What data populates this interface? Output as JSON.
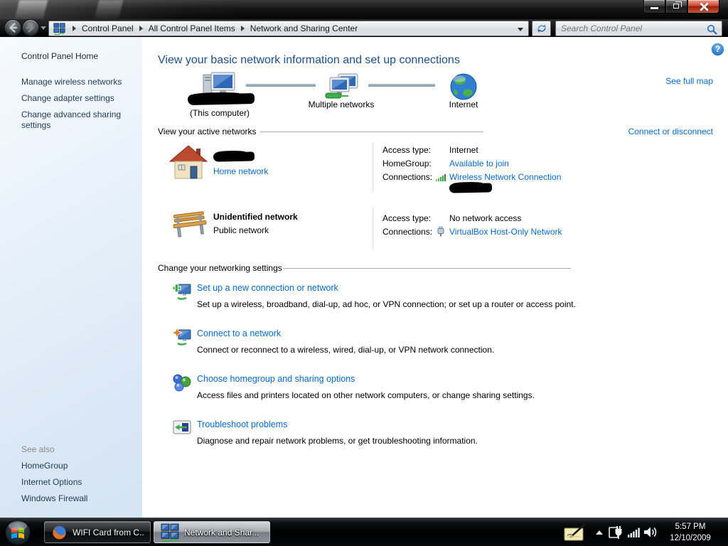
{
  "address_bar": {
    "breadcrumb": {
      "items": [
        "Control Panel",
        "All Control Panel Items",
        "Network and Sharing Center"
      ]
    },
    "search": {
      "placeholder": "Search Control Panel"
    }
  },
  "help": {
    "glyph": "?"
  },
  "sidebar": {
    "home_label": "Control Panel Home",
    "tasks": [
      {
        "label": "Manage wireless networks"
      },
      {
        "label": "Change adapter settings"
      },
      {
        "label": "Change advanced sharing settings"
      }
    ],
    "see_also": {
      "heading": "See also",
      "links": [
        {
          "label": "HomeGroup"
        },
        {
          "label": "Internet Options"
        },
        {
          "label": "Windows Firewall"
        }
      ]
    }
  },
  "main": {
    "title": "View your basic network information and set up connections",
    "see_full_map_label": "See full map",
    "network_map": {
      "computer_caption": "(This computer)",
      "multiple_networks_label": "Multiple networks",
      "internet_label": "Internet"
    },
    "active_networks": {
      "heading": "View your active networks",
      "connect_or_disconnect_label": "Connect or disconnect",
      "home": {
        "type_link": "Home network",
        "access_type_label": "Access type:",
        "access_type_value": "Internet",
        "homegroup_label": "HomeGroup:",
        "homegroup_value": "Available to join",
        "connections_label": "Connections:",
        "connections_value": "Wireless Network Connection"
      },
      "unidentified": {
        "name": "Unidentified network",
        "type": "Public network",
        "access_type_label": "Access type:",
        "access_type_value": "No network access",
        "connections_label": "Connections:",
        "connections_value": "VirtualBox Host-Only Network"
      }
    },
    "settings": {
      "heading": "Change your networking settings",
      "items": [
        {
          "title": "Set up a new connection or network",
          "description": "Set up a wireless, broadband, dial-up, ad hoc, or VPN connection; or set up a router or access point."
        },
        {
          "title": "Connect to a network",
          "description": "Connect or reconnect to a wireless, wired, dial-up, or VPN network connection."
        },
        {
          "title": "Choose homegroup and sharing options",
          "description": "Access files and printers located on other network computers, or change sharing settings."
        },
        {
          "title": "Troubleshoot problems",
          "description": "Diagnose and repair network problems, or get troubleshooting information."
        }
      ]
    }
  },
  "taskbar": {
    "buttons": [
      {
        "label": "WIFI Card from C..."
      },
      {
        "label": "Network and Shar..."
      }
    ],
    "clock": {
      "time": "5:57 PM",
      "date": "12/10/2009"
    }
  },
  "colors": {
    "link_blue": "#0669cc",
    "heading_blue": "#1d4e89",
    "sidebar_link": "#1f3b57"
  }
}
